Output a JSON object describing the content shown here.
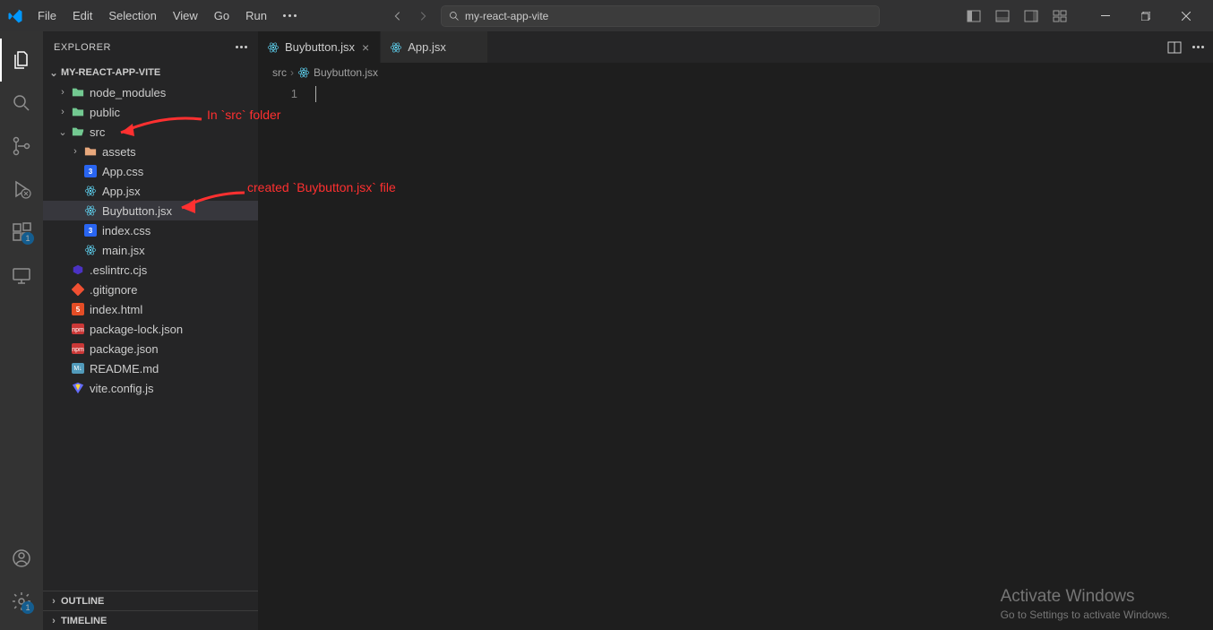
{
  "menu": {
    "items": [
      "File",
      "Edit",
      "Selection",
      "View",
      "Go",
      "Run"
    ]
  },
  "search": {
    "text": "my-react-app-vite"
  },
  "sidebar": {
    "title": "EXPLORER",
    "project": "MY-REACT-APP-VITE",
    "tree": {
      "node_modules": "node_modules",
      "public": "public",
      "src": "src",
      "assets": "assets",
      "app_css": "App.css",
      "app_jsx": "App.jsx",
      "buybutton": "Buybutton.jsx",
      "index_css": "index.css",
      "main_jsx": "main.jsx",
      "eslintrc": ".eslintrc.cjs",
      "gitignore": ".gitignore",
      "index_html": "index.html",
      "pkg_lock": "package-lock.json",
      "pkg": "package.json",
      "readme": "README.md",
      "vite": "vite.config.js"
    },
    "outline": "OUTLINE",
    "timeline": "TIMELINE"
  },
  "tabs": {
    "active": "Buybutton.jsx",
    "second": "App.jsx"
  },
  "breadcrumb": {
    "src": "src",
    "file": "Buybutton.jsx"
  },
  "editor": {
    "line_number": "1"
  },
  "annotations": {
    "src_note": "In `src` folder",
    "file_note": "created `Buybutton.jsx` file"
  },
  "watermark": {
    "title": "Activate Windows",
    "sub": "Go to Settings to activate Windows."
  },
  "badges": {
    "ext": "1",
    "settings": "1"
  }
}
